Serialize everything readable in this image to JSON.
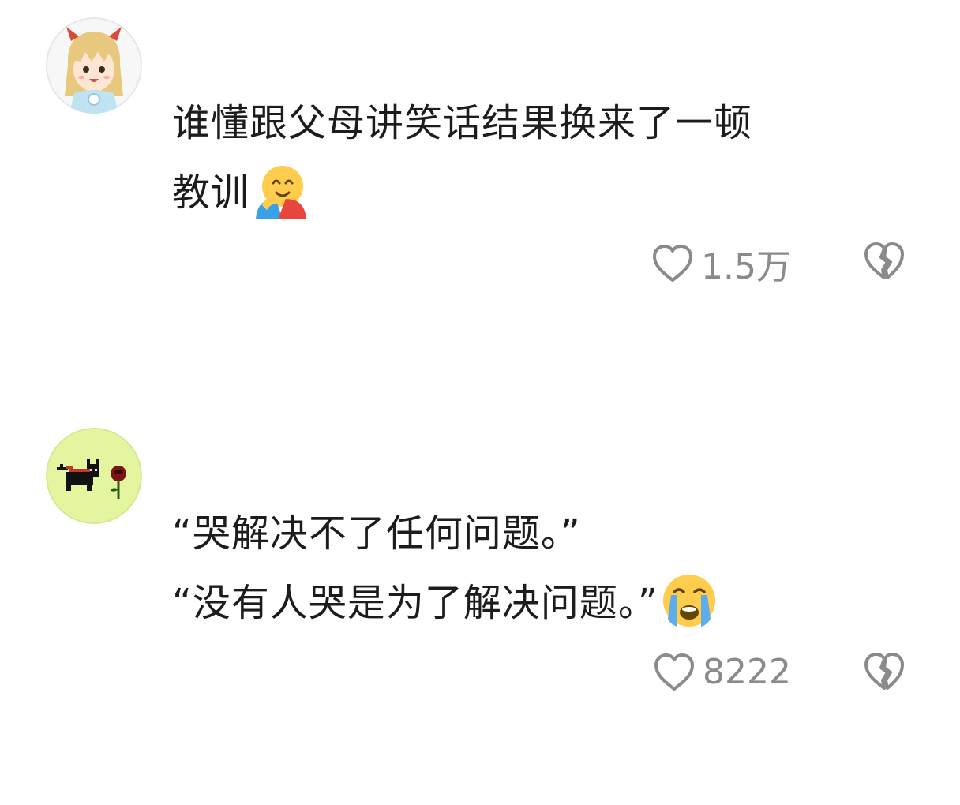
{
  "comments": [
    {
      "avatar": "anime-girl-avatar",
      "lines": [
        "谁懂跟父母讲笑话结果换来了一顿",
        "教训"
      ],
      "emoji": "hugging-face-emoji",
      "likes": "1.5万",
      "like_icon": "heart-outline-icon",
      "dislike_icon": "broken-heart-icon"
    },
    {
      "avatar": "black-cat-rose-avatar",
      "lines": [
        "“哭解决不了任何问题。”",
        "“没有人哭是为了解决问题。”"
      ],
      "emoji": "loudly-crying-face-emoji",
      "likes": "8222",
      "like_icon": "heart-outline-icon",
      "dislike_icon": "broken-heart-icon"
    }
  ],
  "colors": {
    "text": "#1c1c1c",
    "meta": "#8a8a8a",
    "avatar2_bg": "#e4f5a0"
  }
}
